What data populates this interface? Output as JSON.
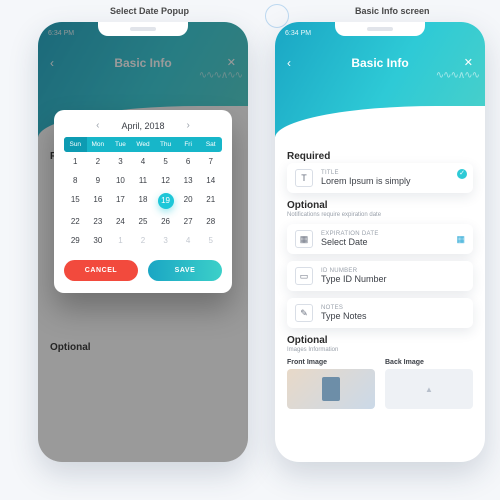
{
  "annotations": {
    "left": "Select Date Popup",
    "right": "Basic Info screen"
  },
  "status_time": "6:34 PM",
  "header": {
    "title": "Basic Info"
  },
  "sections": {
    "required": {
      "title": "Required"
    },
    "optional": {
      "title": "Optional",
      "subtitle": "Notifications require expiration date"
    },
    "images": {
      "title": "Optional",
      "subtitle": "Images Information",
      "front": "Front Image",
      "back": "Back Image"
    }
  },
  "fields": {
    "title_field": {
      "label": "TITLE",
      "value": "Lorem Ipsum is simply"
    },
    "date_field": {
      "label": "EXPIRATION DATE",
      "value": "Select Date"
    },
    "id_field": {
      "label": "ID NUMBER",
      "value": "Type ID Number"
    },
    "notes_field": {
      "label": "NOTES",
      "value": "Type Notes"
    }
  },
  "calendar": {
    "month": "April, 2018",
    "dow": [
      "Sun",
      "Mon",
      "Tue",
      "Wed",
      "Thu",
      "Fri",
      "Sat"
    ],
    "selected": 19,
    "buttons": {
      "cancel": "CANCEL",
      "save": "SAVE"
    },
    "cells": [
      {
        "n": 1
      },
      {
        "n": 2
      },
      {
        "n": 3
      },
      {
        "n": 4
      },
      {
        "n": 5
      },
      {
        "n": 6
      },
      {
        "n": 7
      },
      {
        "n": 8
      },
      {
        "n": 9
      },
      {
        "n": 10
      },
      {
        "n": 11
      },
      {
        "n": 12
      },
      {
        "n": 13
      },
      {
        "n": 14
      },
      {
        "n": 15
      },
      {
        "n": 16
      },
      {
        "n": 17
      },
      {
        "n": 18
      },
      {
        "n": 19,
        "sel": true
      },
      {
        "n": 20
      },
      {
        "n": 21
      },
      {
        "n": 22
      },
      {
        "n": 23
      },
      {
        "n": 24
      },
      {
        "n": 25
      },
      {
        "n": 26
      },
      {
        "n": 27
      },
      {
        "n": 28
      },
      {
        "n": 29
      },
      {
        "n": 30
      },
      {
        "n": 1,
        "mute": true
      },
      {
        "n": 2,
        "mute": true
      },
      {
        "n": 3,
        "mute": true
      },
      {
        "n": 4,
        "mute": true
      },
      {
        "n": 5,
        "mute": true
      }
    ]
  }
}
